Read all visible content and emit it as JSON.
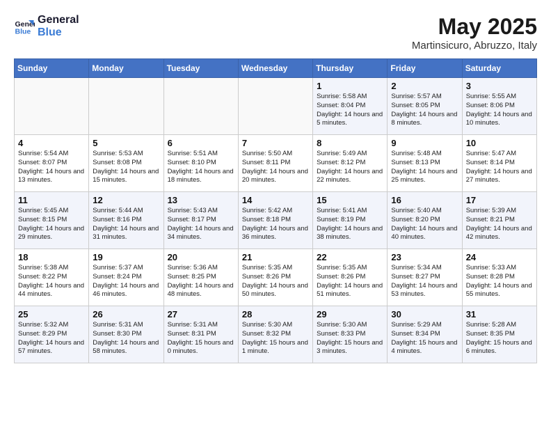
{
  "header": {
    "logo_line1": "General",
    "logo_line2": "Blue",
    "month": "May 2025",
    "location": "Martinsicuro, Abruzzo, Italy"
  },
  "weekdays": [
    "Sunday",
    "Monday",
    "Tuesday",
    "Wednesday",
    "Thursday",
    "Friday",
    "Saturday"
  ],
  "weeks": [
    [
      {
        "day": "",
        "info": ""
      },
      {
        "day": "",
        "info": ""
      },
      {
        "day": "",
        "info": ""
      },
      {
        "day": "",
        "info": ""
      },
      {
        "day": "1",
        "info": "Sunrise: 5:58 AM\nSunset: 8:04 PM\nDaylight: 14 hours\nand 5 minutes."
      },
      {
        "day": "2",
        "info": "Sunrise: 5:57 AM\nSunset: 8:05 PM\nDaylight: 14 hours\nand 8 minutes."
      },
      {
        "day": "3",
        "info": "Sunrise: 5:55 AM\nSunset: 8:06 PM\nDaylight: 14 hours\nand 10 minutes."
      }
    ],
    [
      {
        "day": "4",
        "info": "Sunrise: 5:54 AM\nSunset: 8:07 PM\nDaylight: 14 hours\nand 13 minutes."
      },
      {
        "day": "5",
        "info": "Sunrise: 5:53 AM\nSunset: 8:08 PM\nDaylight: 14 hours\nand 15 minutes."
      },
      {
        "day": "6",
        "info": "Sunrise: 5:51 AM\nSunset: 8:10 PM\nDaylight: 14 hours\nand 18 minutes."
      },
      {
        "day": "7",
        "info": "Sunrise: 5:50 AM\nSunset: 8:11 PM\nDaylight: 14 hours\nand 20 minutes."
      },
      {
        "day": "8",
        "info": "Sunrise: 5:49 AM\nSunset: 8:12 PM\nDaylight: 14 hours\nand 22 minutes."
      },
      {
        "day": "9",
        "info": "Sunrise: 5:48 AM\nSunset: 8:13 PM\nDaylight: 14 hours\nand 25 minutes."
      },
      {
        "day": "10",
        "info": "Sunrise: 5:47 AM\nSunset: 8:14 PM\nDaylight: 14 hours\nand 27 minutes."
      }
    ],
    [
      {
        "day": "11",
        "info": "Sunrise: 5:45 AM\nSunset: 8:15 PM\nDaylight: 14 hours\nand 29 minutes."
      },
      {
        "day": "12",
        "info": "Sunrise: 5:44 AM\nSunset: 8:16 PM\nDaylight: 14 hours\nand 31 minutes."
      },
      {
        "day": "13",
        "info": "Sunrise: 5:43 AM\nSunset: 8:17 PM\nDaylight: 14 hours\nand 34 minutes."
      },
      {
        "day": "14",
        "info": "Sunrise: 5:42 AM\nSunset: 8:18 PM\nDaylight: 14 hours\nand 36 minutes."
      },
      {
        "day": "15",
        "info": "Sunrise: 5:41 AM\nSunset: 8:19 PM\nDaylight: 14 hours\nand 38 minutes."
      },
      {
        "day": "16",
        "info": "Sunrise: 5:40 AM\nSunset: 8:20 PM\nDaylight: 14 hours\nand 40 minutes."
      },
      {
        "day": "17",
        "info": "Sunrise: 5:39 AM\nSunset: 8:21 PM\nDaylight: 14 hours\nand 42 minutes."
      }
    ],
    [
      {
        "day": "18",
        "info": "Sunrise: 5:38 AM\nSunset: 8:22 PM\nDaylight: 14 hours\nand 44 minutes."
      },
      {
        "day": "19",
        "info": "Sunrise: 5:37 AM\nSunset: 8:24 PM\nDaylight: 14 hours\nand 46 minutes."
      },
      {
        "day": "20",
        "info": "Sunrise: 5:36 AM\nSunset: 8:25 PM\nDaylight: 14 hours\nand 48 minutes."
      },
      {
        "day": "21",
        "info": "Sunrise: 5:35 AM\nSunset: 8:26 PM\nDaylight: 14 hours\nand 50 minutes."
      },
      {
        "day": "22",
        "info": "Sunrise: 5:35 AM\nSunset: 8:26 PM\nDaylight: 14 hours\nand 51 minutes."
      },
      {
        "day": "23",
        "info": "Sunrise: 5:34 AM\nSunset: 8:27 PM\nDaylight: 14 hours\nand 53 minutes."
      },
      {
        "day": "24",
        "info": "Sunrise: 5:33 AM\nSunset: 8:28 PM\nDaylight: 14 hours\nand 55 minutes."
      }
    ],
    [
      {
        "day": "25",
        "info": "Sunrise: 5:32 AM\nSunset: 8:29 PM\nDaylight: 14 hours\nand 57 minutes."
      },
      {
        "day": "26",
        "info": "Sunrise: 5:31 AM\nSunset: 8:30 PM\nDaylight: 14 hours\nand 58 minutes."
      },
      {
        "day": "27",
        "info": "Sunrise: 5:31 AM\nSunset: 8:31 PM\nDaylight: 15 hours\nand 0 minutes."
      },
      {
        "day": "28",
        "info": "Sunrise: 5:30 AM\nSunset: 8:32 PM\nDaylight: 15 hours\nand 1 minute."
      },
      {
        "day": "29",
        "info": "Sunrise: 5:30 AM\nSunset: 8:33 PM\nDaylight: 15 hours\nand 3 minutes."
      },
      {
        "day": "30",
        "info": "Sunrise: 5:29 AM\nSunset: 8:34 PM\nDaylight: 15 hours\nand 4 minutes."
      },
      {
        "day": "31",
        "info": "Sunrise: 5:28 AM\nSunset: 8:35 PM\nDaylight: 15 hours\nand 6 minutes."
      }
    ]
  ]
}
